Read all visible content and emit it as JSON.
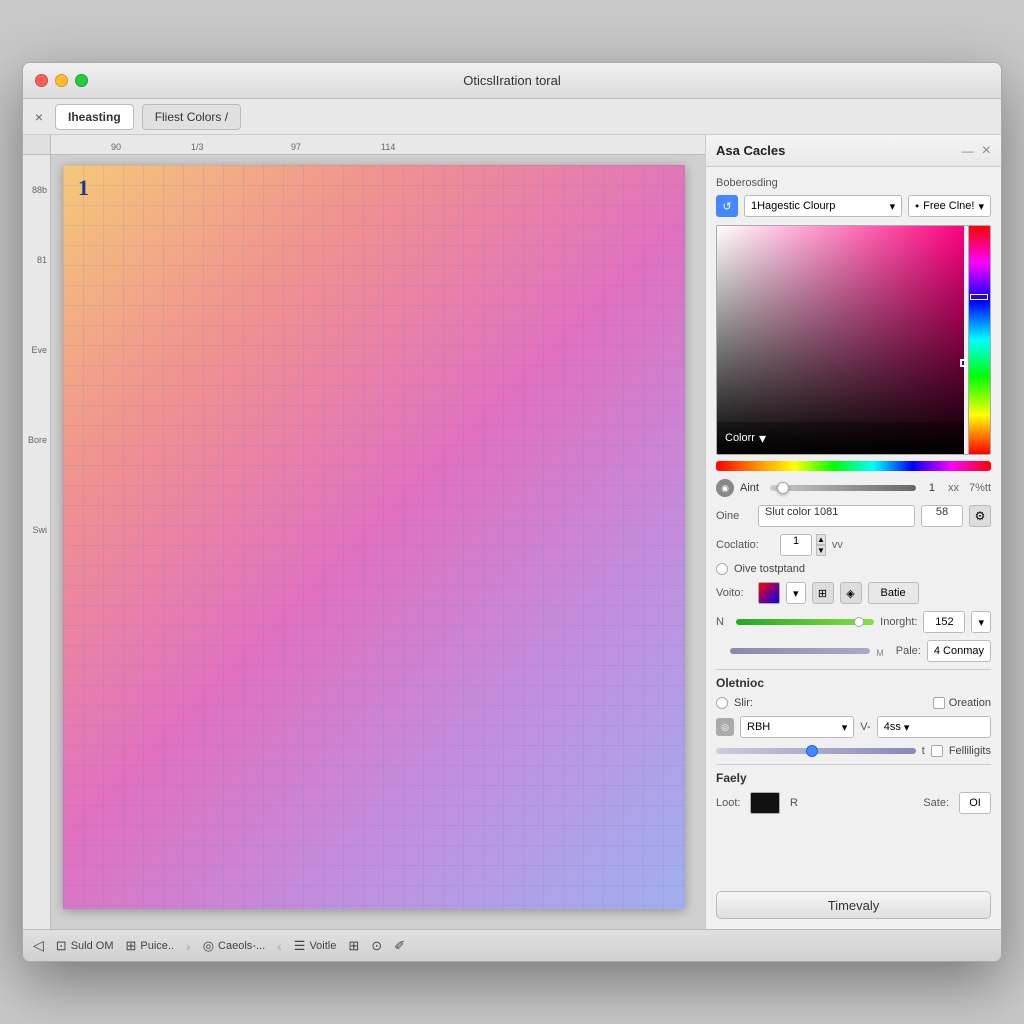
{
  "window": {
    "title": "OticslIration toral",
    "panel_title": "Asa Cacles"
  },
  "toolbar": {
    "close_label": "×",
    "tab1_label": "Iheasting",
    "tab2_label": "Fliest Colors /"
  },
  "ruler": {
    "top_marks": [
      "90",
      "1/3",
      "97",
      "114"
    ],
    "left_marks": [
      "88b",
      "81",
      "Eve",
      "Bore",
      "Swi"
    ]
  },
  "canvas": {
    "page_number": "1"
  },
  "panel": {
    "section_label": "Boberosding",
    "dropdown1_label": "1Hagestic Clourp",
    "dropdown2_label": "Free Clne!",
    "color_label": "Colorr",
    "alpha_label": "Aint",
    "alpha_value": "1",
    "alpha_unit": "xx",
    "alpha_percent": "7%tt",
    "oine_label": "Oine",
    "oine_value": "Slut color 1081",
    "oine_num": "58",
    "coclatio_label": "Coclatio:",
    "coclatio_value": "1",
    "coclatio_unit": "vv",
    "give_label": "Oive tostptand",
    "voito_label": "Voito:",
    "batie_label": "Batie",
    "n_label": "N",
    "inorght_label": "Inorght:",
    "inorght_value": "152",
    "pale_label": "Pale:",
    "pale_value": "4 Conmay",
    "oletnioc_label": "Oletnioc",
    "slir_label": "Slir:",
    "oration_label": "Oreation",
    "rbh_label": "RBH",
    "v_label": "V-",
    "val_label": "4ss",
    "t_label": "t",
    "felliligits_label": "Felliligits",
    "faely_label": "Faely",
    "loot_label": "Loot:",
    "r_label": "R",
    "sate_label": "Sate:",
    "sate_value": "OI",
    "timevaly_label": "Timevaly"
  },
  "statusbar": {
    "item1": "Suld OM",
    "item2": "Puice..",
    "item3": "Caeols-...",
    "item4": "Voitle",
    "arrow1": "‹",
    "arrow2": "›"
  }
}
